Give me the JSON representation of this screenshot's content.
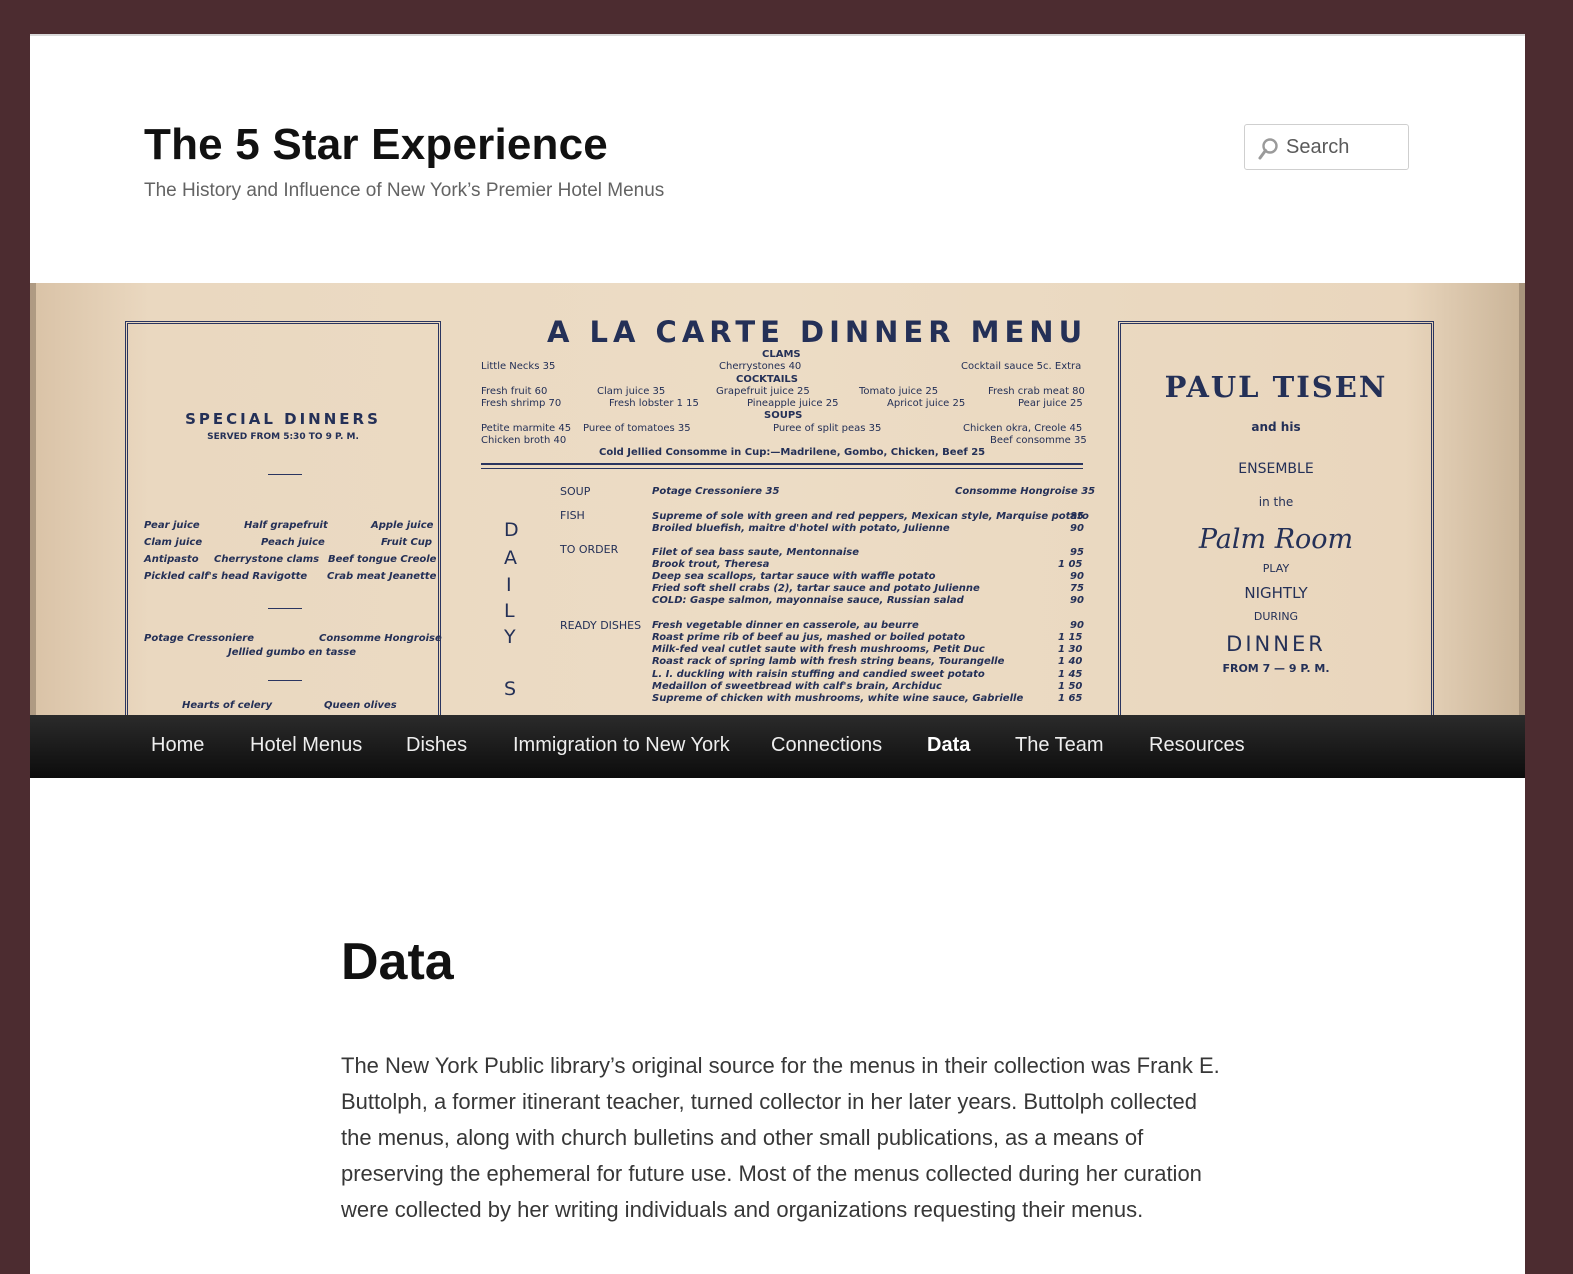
{
  "site": {
    "title": "The 5 Star Experience",
    "description": "The History and Influence of New York’s Premier Hotel Menus"
  },
  "search": {
    "placeholder": "Search"
  },
  "banner": {
    "heading": "A LA CARTE DINNER MENU",
    "left_panel": {
      "title": "SPECIAL DINNERS",
      "subtitle": "SERVED FROM 5:30 TO 9 P. M.",
      "rows": [
        [
          "Pear juice",
          "Half grapefruit",
          "Apple juice"
        ],
        [
          "Clam juice",
          "Peach juice",
          "Fruit Cup"
        ],
        [
          "Antipasto",
          "Cherrystone clams",
          "Beef tongue Creole"
        ],
        [
          "Pickled calf's head Ravigotte",
          "",
          "Crab meat Jeanette"
        ]
      ],
      "soups": [
        "Potage Cressoniere",
        "Consomme Hongroise",
        "Jellied gumbo en tasse"
      ],
      "relishes": [
        "Hearts of celery",
        "Queen olives"
      ]
    },
    "center_top": [
      [
        "Little Necks 35",
        "CLAMS",
        "Cherrystones 40",
        "Cocktail sauce 5c. Extra"
      ],
      [
        "Fresh fruit 60",
        "Clam juice 35",
        "COCKTAILS",
        "Grapefruit juice 25",
        "Tomato juice 25",
        "Fresh crab meat 80"
      ],
      [
        "Fresh shrimp 70",
        "Fresh lobster 1 15",
        "Pineapple juice 25",
        "Apricot juice 25",
        "Pear juice 25"
      ],
      [
        "Petite marmite 45",
        "Puree of tomatoes 35",
        "SOUPS",
        "Puree of split peas 35",
        "Chicken okra, Creole 45"
      ],
      [
        "Chicken broth 40",
        "Beef consomme 35"
      ]
    ],
    "cold_line": "Cold Jellied Consomme in Cup:—Madrilene, Gombo, Chicken, Beef 25",
    "daily_letters": [
      "D",
      "A",
      "I",
      "L",
      "Y",
      "S"
    ],
    "sections": [
      {
        "label": "SOUP",
        "items": [
          [
            "Potage Cressoniere 35",
            ""
          ],
          [
            "Consomme Hongroise 35",
            ""
          ]
        ]
      },
      {
        "label": "FISH",
        "items": [
          [
            "Supreme of sole with green and red peppers, Mexican style, Marquise potato",
            "85"
          ],
          [
            "Broiled bluefish, maitre d'hotel with potato, Julienne",
            "90"
          ]
        ]
      },
      {
        "label": "TO ORDER",
        "items": [
          [
            "Filet of sea bass saute, Mentonnaise",
            "95"
          ],
          [
            "Brook trout, Theresa",
            "1 05"
          ],
          [
            "Deep sea scallops, tartar sauce with waffle potato",
            "90"
          ],
          [
            "Fried soft shell crabs (2), tartar sauce and potato Julienne",
            "75"
          ],
          [
            "COLD: Gaspe salmon, mayonnaise sauce, Russian salad",
            "90"
          ]
        ]
      },
      {
        "label": "READY DISHES",
        "items": [
          [
            "Fresh vegetable dinner en casserole, au beurre",
            "90"
          ],
          [
            "Roast prime rib of beef au jus, mashed or boiled potato",
            "1 15"
          ],
          [
            "Milk-fed veal cutlet saute with fresh mushrooms, Petit Duc",
            "1 30"
          ],
          [
            "Roast rack of spring lamb with fresh string beans, Tourangelle",
            "1 40"
          ],
          [
            "L. I. duckling with raisin stuffing and candied sweet potato",
            "1 45"
          ],
          [
            "Medaillon of sweetbread with calf's brain, Archiduc",
            "1 50"
          ],
          [
            "Supreme of chicken with mushrooms, white wine sauce, Gabrielle",
            "1 65"
          ]
        ]
      }
    ],
    "right_panel": {
      "lines": [
        "PAUL TISEN",
        "and his",
        "ENSEMBLE",
        "in the",
        "Palm Room",
        "PLAY",
        "NIGHTLY",
        "DURING",
        "DINNER",
        "FROM 7 — 9 P. M."
      ]
    }
  },
  "nav": {
    "items": [
      {
        "label": "Home",
        "active": false
      },
      {
        "label": "Hotel Menus",
        "active": false
      },
      {
        "label": "Dishes",
        "active": false
      },
      {
        "label": "Immigration to New York",
        "active": false
      },
      {
        "label": "Connections",
        "active": false
      },
      {
        "label": "Data",
        "active": true
      },
      {
        "label": "The Team",
        "active": false
      },
      {
        "label": "Resources",
        "active": false
      }
    ]
  },
  "entry": {
    "title": "Data",
    "paragraph": "The New York Public library’s original source for the menus in their collection was Frank E. Buttolph, a former itinerant teacher, turned collector in her later years.  Buttolph collected the menus, along with church bulletins and other small publications, as a means of preserving the ephemeral for future use.  Most of the menus collected during her curation were collected by her writing individuals and organizations requesting their menus."
  },
  "colors": {
    "frame": "#4c2c30",
    "nav_bg": "#111111",
    "menu_ink": "#243057",
    "paper": "#ecdcc5"
  }
}
